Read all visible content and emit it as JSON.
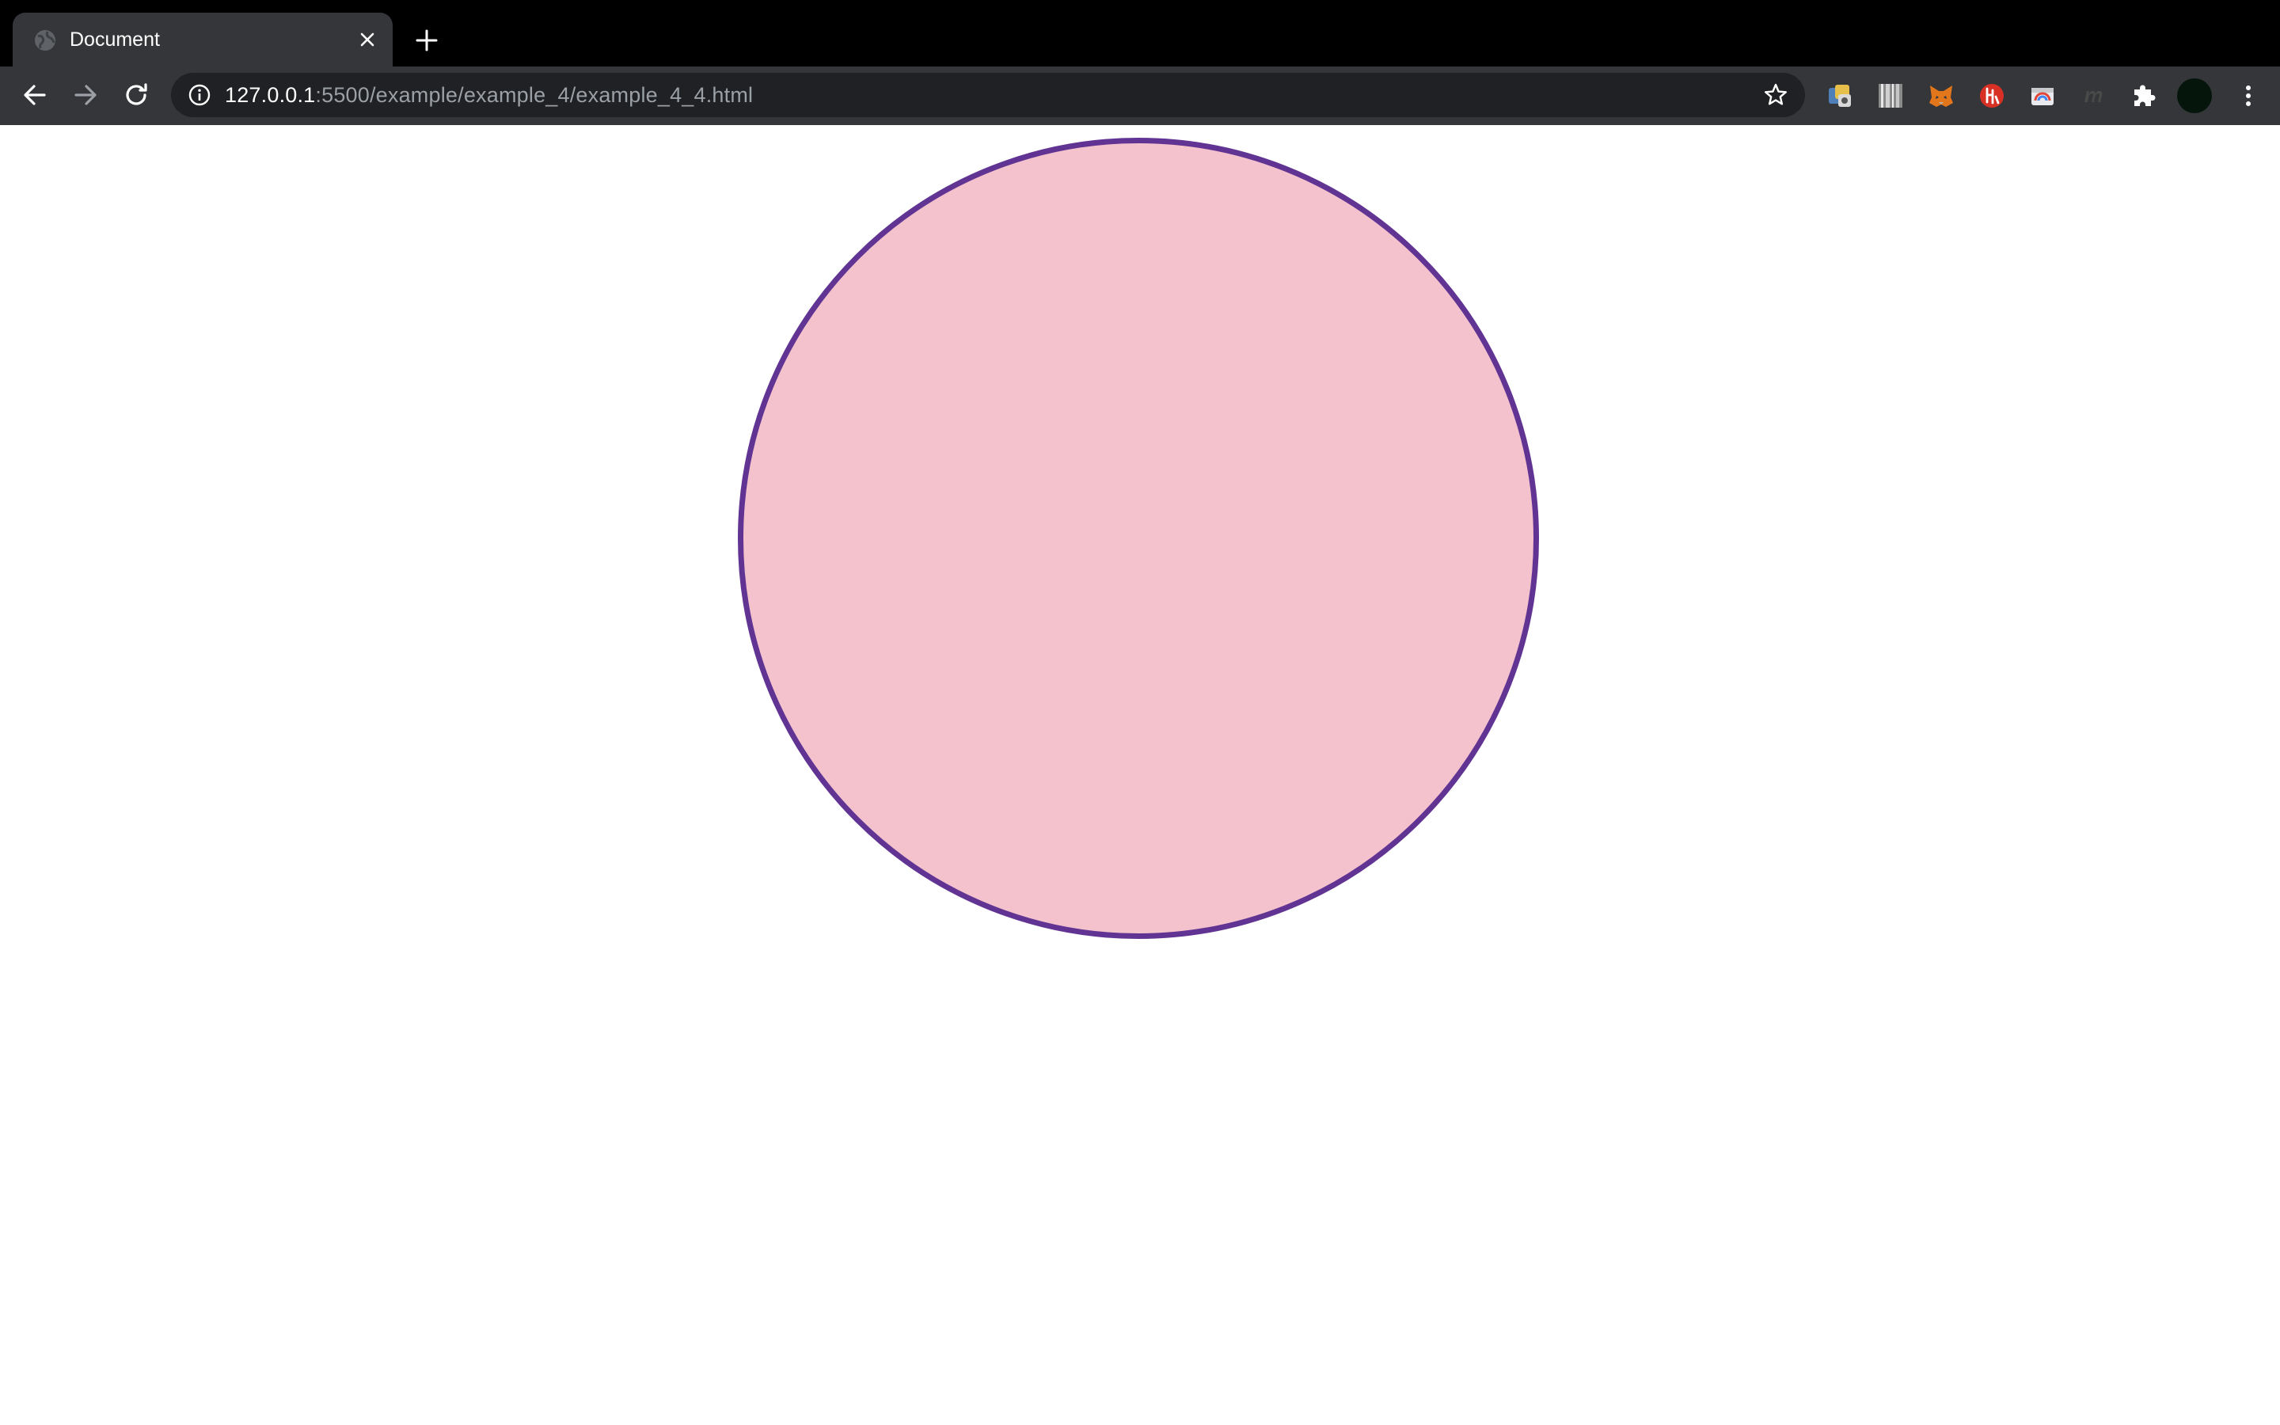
{
  "tab": {
    "title": "Document",
    "favicon": "globe-icon",
    "close_icon": "close-icon"
  },
  "new_tab_icon": "plus-icon",
  "toolbar": {
    "back_icon": "arrow-left-icon",
    "forward_icon": "arrow-right-icon",
    "reload_icon": "reload-icon"
  },
  "address_bar": {
    "info_icon": "info-icon",
    "url_host": "127.0.0.1",
    "url_path": ":5500/example/example_4/example_4_4.html",
    "bookmark_icon": "star-icon"
  },
  "extensions": [
    "tampermonkey-extension-icon",
    "barcode-extension-icon",
    "metamask-fox-extension-icon",
    "red-circle-extension-icon",
    "card-extension-icon",
    "faded-m-extension-icon",
    "puzzle-piece-icon"
  ],
  "profile_icon": "avatar",
  "menu_icon": "vertical-dots-icon",
  "page": {
    "shape": "circle",
    "fill_color": "#f4c2cc",
    "border_color": "#613494",
    "background_color": "#ffffff"
  },
  "colors": {
    "tabstrip": "#000000",
    "toolbar": "#35363a",
    "omnibox": "#202124",
    "text_primary": "#ffffff",
    "text_secondary": "#9aa0a6"
  }
}
